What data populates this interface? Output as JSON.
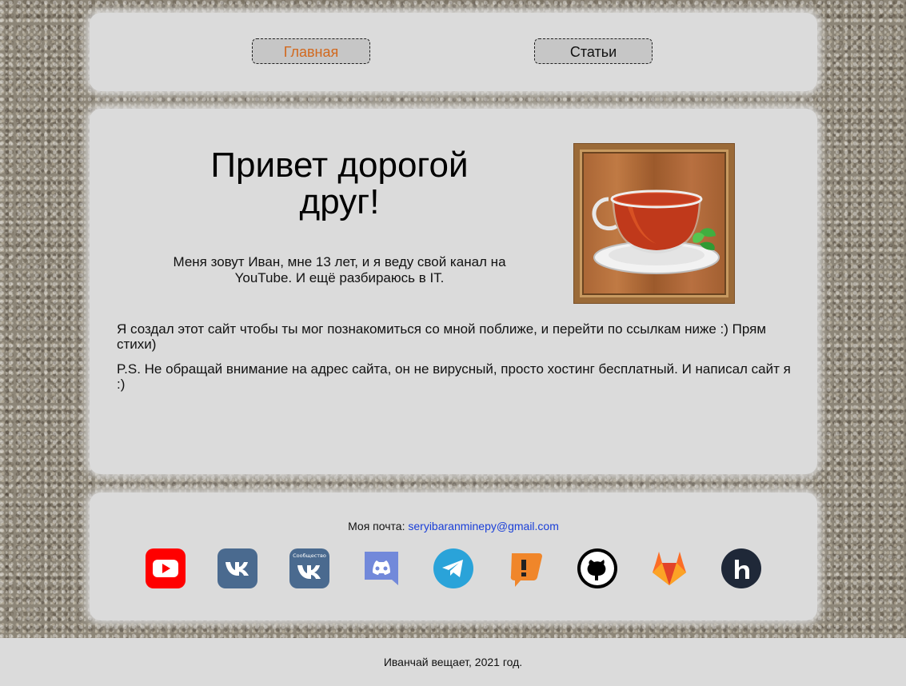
{
  "nav": {
    "home_label": "Главная",
    "articles_label": "Статьи"
  },
  "main": {
    "title": "Привет дорогой друг!",
    "intro": "Меня зовут Иван, мне 13 лет, и я веду свой канал на YouTube. И ещё разбираюсь в IT.",
    "paragraph1": "Я создал этот сайт чтобы ты мог познакомиться со мной поближе, и перейти по ссылкам ниже :) Прям стихи)",
    "paragraph2": "P.S. Не обращай внимание на адрес сайта, он не вирусный, просто хостинг бесплатный. И написал сайт я :)",
    "image": "tea-cup-picture"
  },
  "contacts": {
    "email_label": "Моя почта:",
    "email": "seryibaranminepy@gmail.com",
    "vk_group_caption": "Сообщество",
    "icons": [
      "youtube-icon",
      "vk-icon",
      "vk-community-icon",
      "discord-icon",
      "telegram-icon",
      "boosty-icon",
      "github-icon",
      "gitlab-icon",
      "habr-icon"
    ]
  },
  "footer": {
    "text": "Иванчай вещает, 2021 год."
  },
  "colors": {
    "panel": "#dbdbdb",
    "active_nav": "#d2691e",
    "link": "#1a3fd8"
  }
}
